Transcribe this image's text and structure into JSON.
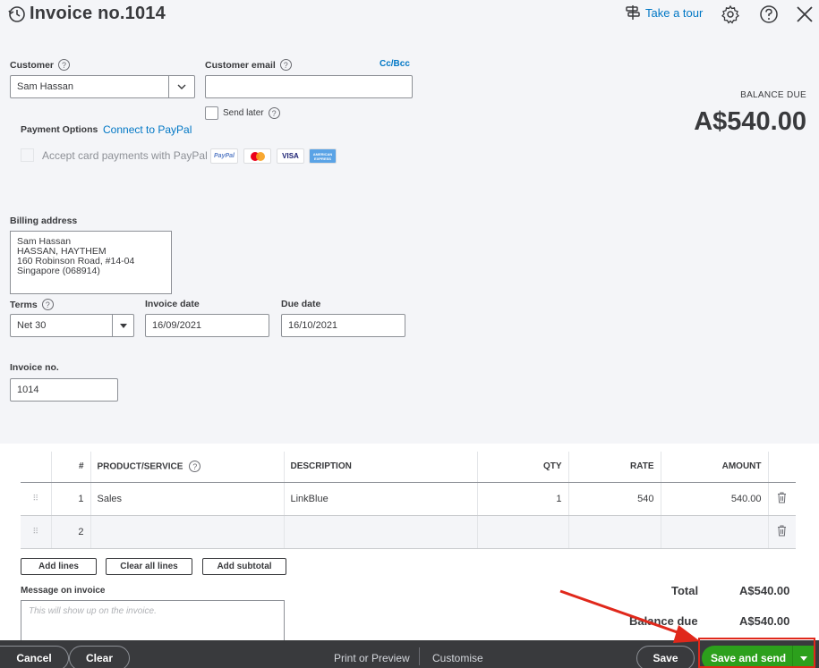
{
  "header": {
    "title": "Invoice no.1014",
    "take_tour": "Take a tour"
  },
  "customer": {
    "label": "Customer",
    "value": "Sam Hassan"
  },
  "email": {
    "label": "Customer email",
    "value": "",
    "cc_bcc": "Cc/Bcc"
  },
  "send_later": "Send later",
  "payment": {
    "label": "Payment Options",
    "connect": "Connect to PayPal",
    "accept": "Accept card payments with PayPal",
    "cards": [
      "PayPal",
      "",
      "VISA",
      "AMERICAN EXPRESS"
    ]
  },
  "balance": {
    "label": "BALANCE DUE",
    "amount": "A$540.00"
  },
  "billing": {
    "label": "Billing address",
    "lines": [
      "Sam Hassan",
      "HASSAN, HAYTHEM",
      "160 Robinson Road, #14-04",
      "Singapore (068914)"
    ]
  },
  "terms": {
    "label": "Terms",
    "value": "Net 30"
  },
  "invoice_date": {
    "label": "Invoice date",
    "value": "16/09/2021"
  },
  "due_date": {
    "label": "Due date",
    "value": "16/10/2021"
  },
  "invoice_no": {
    "label": "Invoice no.",
    "value": "1014"
  },
  "table": {
    "headers": [
      "#",
      "PRODUCT/SERVICE",
      "DESCRIPTION",
      "QTY",
      "RATE",
      "AMOUNT"
    ],
    "rows": [
      {
        "num": "1",
        "product": "Sales",
        "description": "LinkBlue",
        "qty": "1",
        "rate": "540",
        "amount": "540.00"
      },
      {
        "num": "2",
        "product": "",
        "description": "",
        "qty": "",
        "rate": "",
        "amount": ""
      }
    ]
  },
  "buttons": {
    "add_lines": "Add lines",
    "clear_all": "Clear all lines",
    "add_subtotal": "Add subtotal"
  },
  "message": {
    "label": "Message on invoice",
    "placeholder": "This will show up on the invoice."
  },
  "totals": {
    "total_label": "Total",
    "total_value": "A$540.00",
    "balance_label": "Balance due",
    "balance_value": "A$540.00"
  },
  "footer": {
    "cancel": "Cancel",
    "clear": "Clear",
    "print": "Print or Preview",
    "customise": "Customise",
    "save": "Save",
    "save_send": "Save and send"
  }
}
